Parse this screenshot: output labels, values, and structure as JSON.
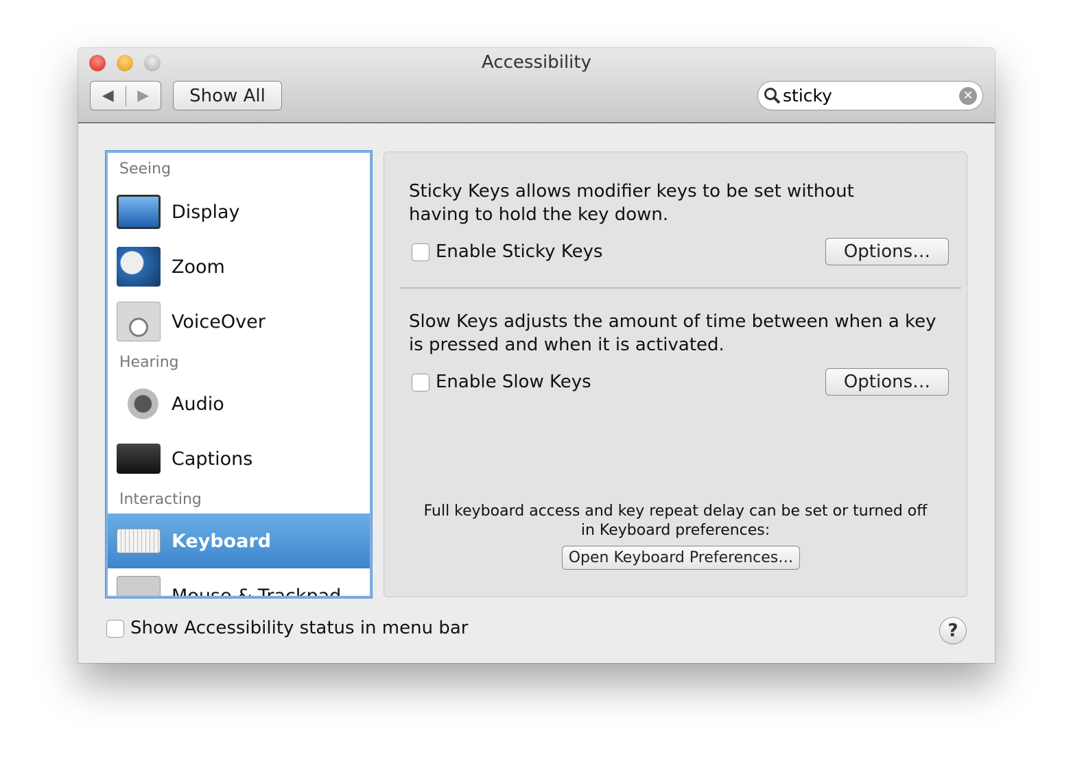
{
  "window": {
    "title": "Accessibility"
  },
  "toolbar": {
    "back": "◀",
    "forward": "▶",
    "show_all": "Show All",
    "search_value": "sticky",
    "search_icon": "magnifier-icon",
    "clear_icon": "✕"
  },
  "sidebar": {
    "sections": [
      {
        "label": "Seeing",
        "items": [
          "Display",
          "Zoom",
          "VoiceOver"
        ]
      },
      {
        "label": "Hearing",
        "items": [
          "Audio",
          "Captions"
        ]
      },
      {
        "label": "Interacting",
        "items": [
          "Keyboard",
          "Mouse & Trackpad"
        ]
      }
    ],
    "selected": "Keyboard"
  },
  "pane": {
    "sticky_desc": "Sticky Keys allows modifier keys to be set without having to hold the key down.",
    "sticky_checkbox": "Enable Sticky Keys",
    "sticky_checked": false,
    "sticky_options": "Options…",
    "slow_desc": "Slow Keys adjusts the amount of time between when a key is pressed and when it is activated.",
    "slow_checkbox": "Enable Slow Keys",
    "slow_checked": false,
    "slow_options": "Options…",
    "note": "Full keyboard access and key repeat delay can be set or turned off in Keyboard preferences:",
    "open_keyboard": "Open Keyboard Preferences…"
  },
  "footer": {
    "status_checkbox": "Show Accessibility status in menu bar",
    "status_checked": false,
    "help": "?"
  },
  "colors": {
    "selection": "#3d86cc",
    "close": "#e0443e",
    "minimize": "#f0b030"
  }
}
